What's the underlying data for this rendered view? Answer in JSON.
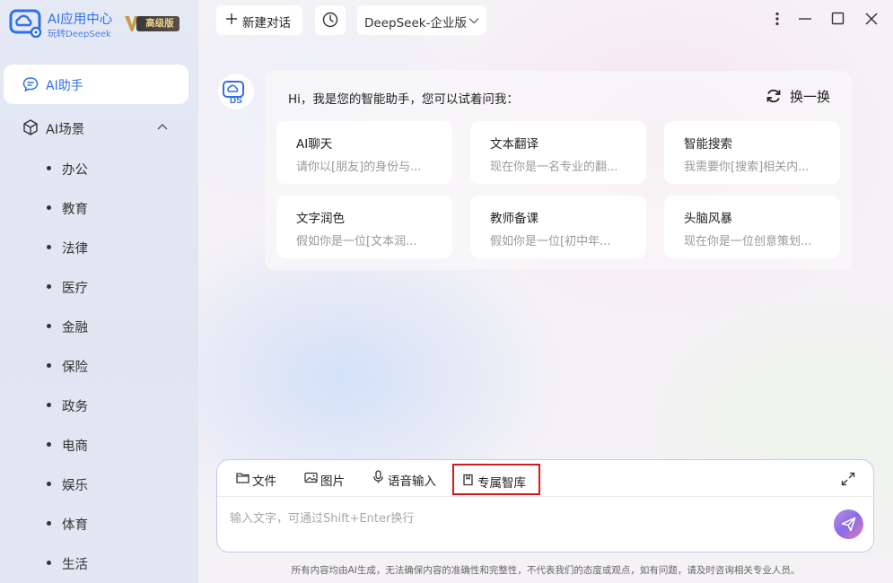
{
  "brand": {
    "title": "AI应用中心",
    "subtitle": "玩转DeepSeek",
    "vip_badge": "高级版",
    "accent": "#2f6fe8"
  },
  "sidebar": {
    "assistant_label": "AI助手",
    "scenes_label": "AI场景",
    "scenes_expanded": true,
    "scene_items": [
      {
        "label": "办公"
      },
      {
        "label": "教育"
      },
      {
        "label": "法律"
      },
      {
        "label": "医疗"
      },
      {
        "label": "金融"
      },
      {
        "label": "保险"
      },
      {
        "label": "政务"
      },
      {
        "label": "电商"
      },
      {
        "label": "娱乐"
      },
      {
        "label": "体育"
      },
      {
        "label": "生活"
      }
    ]
  },
  "topbar": {
    "new_chat_label": "新建对话",
    "history_icon": "clock-icon",
    "model_selected": "DeepSeek-企业版"
  },
  "window_controls": [
    "more-icon",
    "minimize-icon",
    "maximize-icon",
    "close-icon"
  ],
  "greeting": {
    "avatar_text": "DS",
    "text": "Hi，我是您的智能助手，您可以试着问我：",
    "refresh_label": "换一换"
  },
  "prompts": [
    {
      "title": "AI聊天",
      "desc": "请你以[朋友]的身份与..."
    },
    {
      "title": "文本翻译",
      "desc": "现在你是一名专业的翻..."
    },
    {
      "title": "智能搜索",
      "desc": "我需要你[搜索]相关内..."
    },
    {
      "title": "文字润色",
      "desc": "假如你是一位[文本润..."
    },
    {
      "title": "教师备课",
      "desc": "假如你是一位[初中年..."
    },
    {
      "title": "头脑风暴",
      "desc": "现在你是一位创意策划..."
    }
  ],
  "input": {
    "tools": [
      {
        "label": "文件",
        "icon": "folder-icon"
      },
      {
        "label": "图片",
        "icon": "image-icon"
      },
      {
        "label": "语音输入",
        "icon": "microphone-icon"
      },
      {
        "label": "专属智库",
        "icon": "knowledge-base-icon",
        "highlighted": true
      }
    ],
    "placeholder": "输入文字，可通过Shift+Enter换行",
    "value": ""
  },
  "disclaimer": "所有内容均由AI生成，无法确保内容的准确性和完整性，不代表我们的态度或观点，如有问题，请及时咨询相关专业人员。"
}
